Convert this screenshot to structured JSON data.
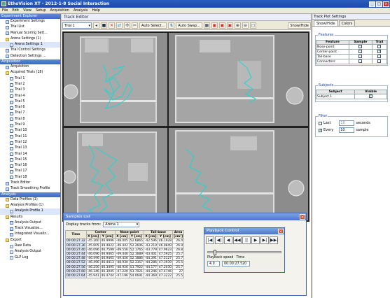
{
  "window": {
    "title": "EthoVision XT - 2012-1-8 Social Interaction",
    "minimize": "_",
    "maximize": "□",
    "close": "×"
  },
  "menu": [
    "File",
    "Edit",
    "View",
    "Setup",
    "Acquisition",
    "Analysis",
    "Help"
  ],
  "explorer": {
    "title": "Experiment Explorer",
    "setup_items": [
      {
        "label": "Experiment Settings",
        "indent": 1,
        "icon": "settings-icon"
      },
      {
        "label": "Trial List",
        "indent": 1,
        "icon": "list-icon"
      },
      {
        "label": "Manual Scoring Sett...",
        "indent": 1,
        "icon": "settings-icon"
      },
      {
        "label": "Arena Settings (1)",
        "indent": 1,
        "icon": "folder-icon"
      },
      {
        "label": "Arena Settings 1",
        "indent": 2,
        "icon": "grid-icon"
      },
      {
        "label": "Trial Control Settings",
        "indent": 1,
        "icon": "settings-icon"
      },
      {
        "label": "Detection Settings ...",
        "indent": 1,
        "icon": "settings-icon"
      }
    ],
    "acquisition_header": "Acquisition",
    "acquisition_items": [
      {
        "label": "Acquisition",
        "indent": 1,
        "icon": "camera-icon"
      },
      {
        "label": "Acquired Trials (18)",
        "indent": 1,
        "icon": "folder-icon"
      }
    ],
    "trials": [
      "Trial 1",
      "Trial 2",
      "Trial 3",
      "Trial 4",
      "Trial 5",
      "Trial 6",
      "Trial 7",
      "Trial 8",
      "Trial 9",
      "Trial 10",
      "Trial 11",
      "Trial 12",
      "Trial 13",
      "Trial 14",
      "Trial 15",
      "Trial 16",
      "Trial 17",
      "Trial 18"
    ],
    "post_items": [
      {
        "label": "Track Editor",
        "indent": 1,
        "icon": "track-icon"
      },
      {
        "label": "Track Smoothing Profile",
        "indent": 1,
        "icon": "track-icon"
      }
    ],
    "analysis_header": "Analysis",
    "analysis_items": [
      {
        "label": "Data Profiles (1)",
        "indent": 1,
        "icon": "folder-icon"
      },
      {
        "label": "Analysis Profiles (1)",
        "indent": 1,
        "icon": "folder-icon"
      },
      {
        "label": "Analysis Profile 1",
        "indent": 2,
        "icon": "grid-icon"
      },
      {
        "label": "Results",
        "indent": 1,
        "icon": "folder-icon"
      },
      {
        "label": "Analysis Output",
        "indent": 2,
        "icon": "chart-icon"
      },
      {
        "label": "Track Visualize...",
        "indent": 2,
        "icon": "track-icon"
      },
      {
        "label": "Integrated Visualiz...",
        "indent": 2,
        "icon": "chart-icon"
      },
      {
        "label": "Export",
        "indent": 1,
        "icon": "folder-icon"
      },
      {
        "label": "Raw Data",
        "indent": 2,
        "icon": "grid-icon"
      },
      {
        "label": "Analysis Output",
        "indent": 2,
        "icon": "grid-icon"
      },
      {
        "label": "GLP Log",
        "indent": 2,
        "icon": "grid-icon"
      }
    ]
  },
  "track_editor": {
    "title": "Track Editor",
    "trial_select": "Trial 1",
    "auto_select": "Auto Select...",
    "auto_swap": "Auto Swap...",
    "show_hide": "Show/Hide"
  },
  "right_panel": {
    "title": "Track Plot Settings",
    "tabs": [
      "Show/Hide",
      "Colors"
    ],
    "features_title": "Features",
    "features_headers": [
      "Feature",
      "Sample",
      "Trail"
    ],
    "features": [
      {
        "name": "Nose-point",
        "sample": false,
        "trail": false
      },
      {
        "name": "Center-point",
        "sample": false,
        "trail": true
      },
      {
        "name": "Tail-base",
        "sample": false,
        "trail": false
      },
      {
        "name": "Connectors",
        "sample": false,
        "trail": false
      }
    ],
    "subjects_title": "Subjects",
    "subjects_headers": [
      "Subject",
      "Visible"
    ],
    "subjects": [
      {
        "name": "Subject 1",
        "visible": true
      }
    ],
    "filter_title": "Filter",
    "filter_last": "Last",
    "filter_last_value": "10",
    "filter_last_unit": "seconds",
    "filter_every": "Every",
    "filter_every_value": "10",
    "filter_every_unit": "sample"
  },
  "samples_list": {
    "title": "Samples List",
    "display_label": "Display tracks from:",
    "display_value": "Arena 1",
    "group_headers": [
      "Time",
      "Center",
      "Nose-point",
      "Tail-base",
      "Area"
    ],
    "col_headers": [
      "X [cm]",
      "Y [cm]",
      "X [cm]",
      "Y [cm]",
      "X [cm]",
      "Y [cm]",
      "[cm²]"
    ],
    "rows": [
      [
        "00:00:27.32",
        "-45.260",
        "46.9996",
        "-48.005",
        "52.6865",
        "-42.596",
        "46.1928",
        "26.4"
      ],
      [
        "00:00:27.36",
        "-45.605",
        "49.4922",
        "-49.442",
        "52.2606",
        "-43.219",
        "46.9849",
        "26.9"
      ],
      [
        "00:00:27.40",
        "-46.096",
        "46.7599",
        "-49.556",
        "52.1765",
        "-43.779",
        "47.9623",
        "26.8"
      ],
      [
        "00:00:27.44",
        "-46.096",
        "46.9465",
        "-49.446",
        "52.1689",
        "-43.401",
        "47.5925",
        "25.7"
      ],
      [
        "00:00:27.48",
        "-46.496",
        "46.9465",
        "-49.456",
        "52.1886",
        "-44.391",
        "47.5127",
        "25.7"
      ],
      [
        "00:00:27.52",
        "-46.496",
        "46.4413",
        "-48.930",
        "52.3357",
        "-44.286",
        "47.3939",
        "25.5"
      ],
      [
        "00:00:27.56",
        "-46.256",
        "46.3495",
        "-48.926",
        "53.7922",
        "-44.177",
        "47.2030",
        "25.7"
      ],
      [
        "00:00:27.60",
        "-46.346",
        "46.3045",
        "-47.220",
        "53.7921",
        "-44.246",
        "47.4746",
        "27"
      ],
      [
        "00:00:27.64",
        "-45.941",
        "46.4744",
        "-47.196",
        "54.0691",
        "-44.369",
        "47.3222",
        "25.5"
      ]
    ]
  },
  "playback": {
    "title": "Playback Control",
    "buttons": [
      "|◀",
      "◀|",
      "◀",
      "◀◀",
      "||",
      "▶",
      "▶|",
      "▶▶|"
    ],
    "speed_label": "Playback speed",
    "speed_value": "4.0",
    "time_label": "Time",
    "time_value": "00:00:27.520",
    "position": 0.08
  }
}
